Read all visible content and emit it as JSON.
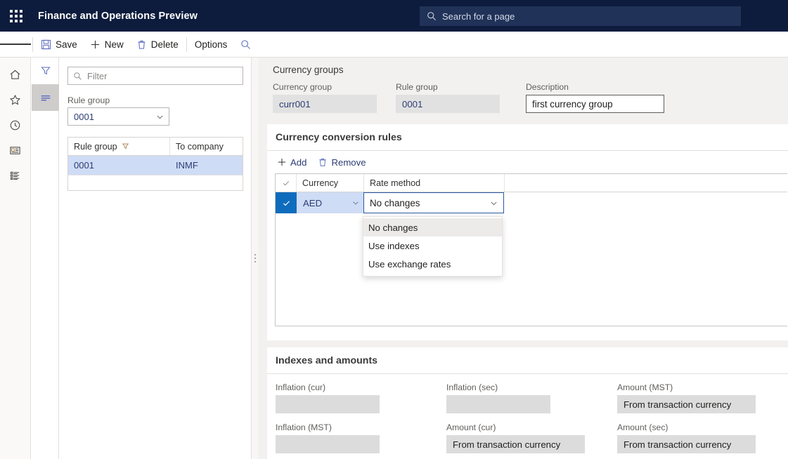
{
  "topbar": {
    "waffle_icon": "waffle-icon",
    "app_title": "Finance and Operations Preview",
    "search_placeholder": "Search for a page",
    "search_icon": "search-icon"
  },
  "commandbar": {
    "hamburger_icon": "hamburger-icon",
    "buttons": [
      {
        "label": "Save",
        "icon": "save-icon"
      },
      {
        "label": "New",
        "icon": "plus-icon"
      },
      {
        "label": "Delete",
        "icon": "trash-icon"
      },
      {
        "label": "Options",
        "icon": ""
      }
    ],
    "search_icon": "search-icon"
  },
  "rail": {
    "items": [
      {
        "icon": "home-icon",
        "name": "home"
      },
      {
        "icon": "star-icon",
        "name": "favorites"
      },
      {
        "icon": "clock-icon",
        "name": "recent"
      },
      {
        "icon": "workspace-icon",
        "name": "workspaces"
      },
      {
        "icon": "modules-list-icon",
        "name": "modules"
      }
    ]
  },
  "navtabs": {
    "items": [
      {
        "icon": "filter-funnel-icon",
        "name": "filter-tab",
        "active": false
      },
      {
        "icon": "list-lines-icon",
        "name": "list-tab",
        "active": true
      }
    ]
  },
  "filterpane": {
    "filter_placeholder": "Filter",
    "filter_icon": "search-icon",
    "rule_group_label": "Rule group",
    "rule_group_value": "0001",
    "chevron_icon": "chevron-down-icon",
    "grid": {
      "columns": [
        "Rule group",
        "To company"
      ],
      "column_filter_icon": "filter-funnel-icon",
      "rows": [
        {
          "rule_group": "0001",
          "to_company": "INMF",
          "selected": true
        }
      ]
    }
  },
  "splitter": {
    "handle_icon": "grip-dots-icon"
  },
  "currency_groups": {
    "title": "Currency groups",
    "fields": [
      {
        "label": "Currency group",
        "value": "curr001",
        "readonly": true
      },
      {
        "label": "Rule group",
        "value": "0001",
        "readonly": true
      },
      {
        "label": "Description",
        "value": "first currency group",
        "readonly": false
      }
    ]
  },
  "conversion_rules": {
    "title": "Currency conversion rules",
    "toolbar": [
      {
        "label": "Add",
        "icon": "plus-icon"
      },
      {
        "label": "Remove",
        "icon": "trash-icon"
      }
    ],
    "grid": {
      "check_header_icon": "checkmark-icon",
      "columns": [
        "Currency",
        "Rate method"
      ],
      "rows": [
        {
          "selected": true,
          "check_icon": "checkmark-icon",
          "currency": "AED",
          "rate_method": "No changes",
          "chevron_icon": "chevron-down-icon"
        }
      ]
    },
    "dropdown": {
      "open": true,
      "options": [
        "No changes",
        "Use indexes",
        "Use exchange rates"
      ],
      "highlighted": "No changes"
    }
  },
  "indexes_and_amounts": {
    "title": "Indexes and amounts",
    "row1": [
      {
        "label": "Inflation (cur)",
        "value": "",
        "size": "narrow"
      },
      {
        "label": "Inflation (sec)",
        "value": "",
        "size": "narrow"
      },
      {
        "label": "Amount (MST)",
        "value": "From transaction currency",
        "size": "wide"
      }
    ],
    "row2": [
      {
        "label": "Inflation (MST)",
        "value": "",
        "size": "narrow"
      },
      {
        "label": "Amount (cur)",
        "value": "From transaction currency",
        "size": "wide"
      },
      {
        "label": "Amount (sec)",
        "value": "From transaction currency",
        "size": "wide"
      }
    ]
  },
  "colors": {
    "brand_navy": "#0d1c3d",
    "search_field": "#203258",
    "accent_blue": "#0f6cbd",
    "selection_row": "#cfdcf5",
    "link_text": "#2c3e75",
    "readonly_field": "#e1e1e1",
    "page_bg": "#f2f1f0"
  }
}
